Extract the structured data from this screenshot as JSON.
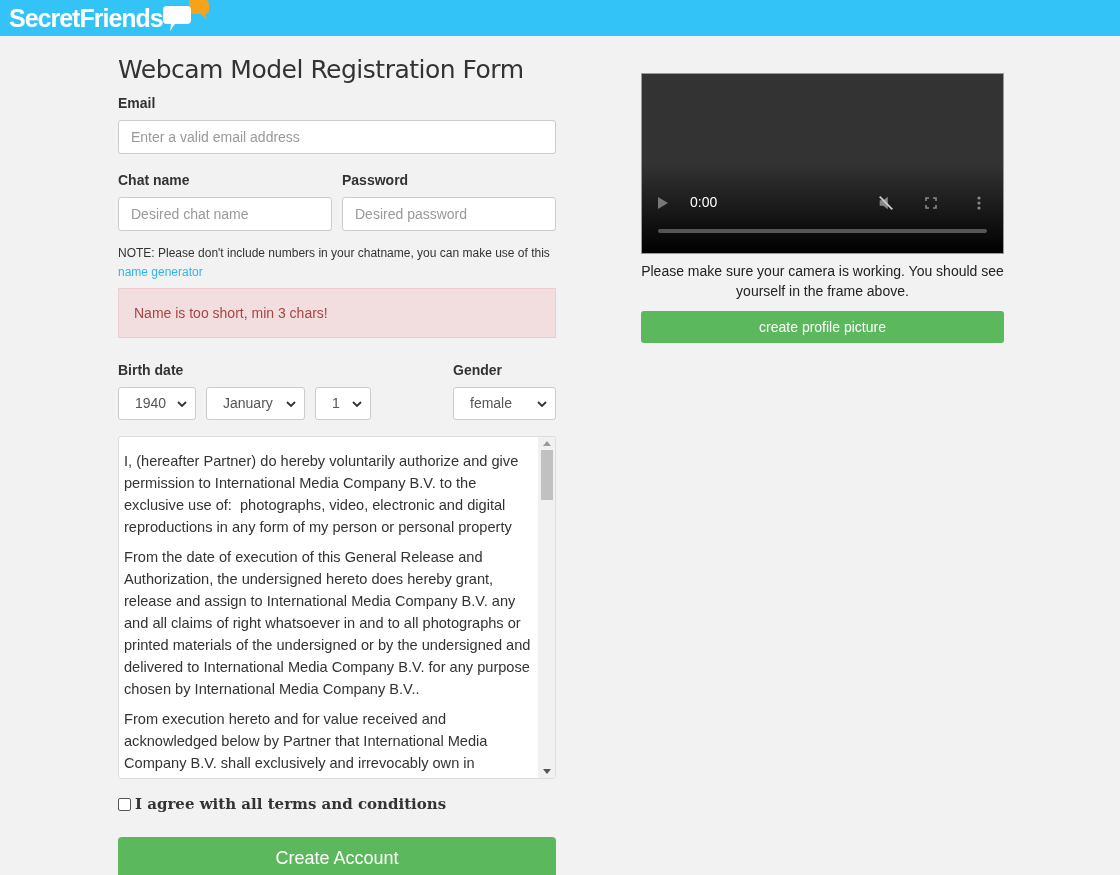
{
  "header": {
    "logo": "SecretFriends"
  },
  "form": {
    "title": "Webcam Model Registration Form",
    "email": {
      "label": "Email",
      "placeholder": "Enter a valid email address"
    },
    "chat_name": {
      "label": "Chat name",
      "placeholder": "Desired chat name"
    },
    "password": {
      "label": "Password",
      "placeholder": "Desired password"
    },
    "note": {
      "text": "NOTE: Please don't include numbers in your chatname, you can make use of this",
      "link": "name generator"
    },
    "error": "Name is too short, min 3 chars!",
    "birth_date": {
      "label": "Birth date",
      "year": "1940",
      "month": "January",
      "day": "1"
    },
    "gender": {
      "label": "Gender",
      "value": "female"
    },
    "terms": [
      "I, (hereafter Partner) do hereby voluntarily authorize and give permission to International Media Company B.V. to the exclusive use of:  photographs, video, electronic and digital reproductions in any form of my person or personal property",
      "From the date of execution of this General Release and Authorization, the undersigned hereto does hereby grant, release and assign to International Media Company B.V. any and all claims of right whatsoever in and to all photographs or printed materials of the undersigned or by the undersigned and delivered to International Media Company B.V. for any purpose chosen by International Media Company B.V..",
      "From execution hereto and for value received and acknowledged below by Partner that International Media Company B.V. shall exclusively and irrevocably own in"
    ],
    "agree": {
      "label": "I agree with all terms and conditions",
      "checked": false
    },
    "submit": "Create Account"
  },
  "camera": {
    "time": "0:00",
    "muted": true,
    "hint": "Please make sure your camera is working. You should see yourself in the frame above.",
    "button": "create profile picture"
  }
}
